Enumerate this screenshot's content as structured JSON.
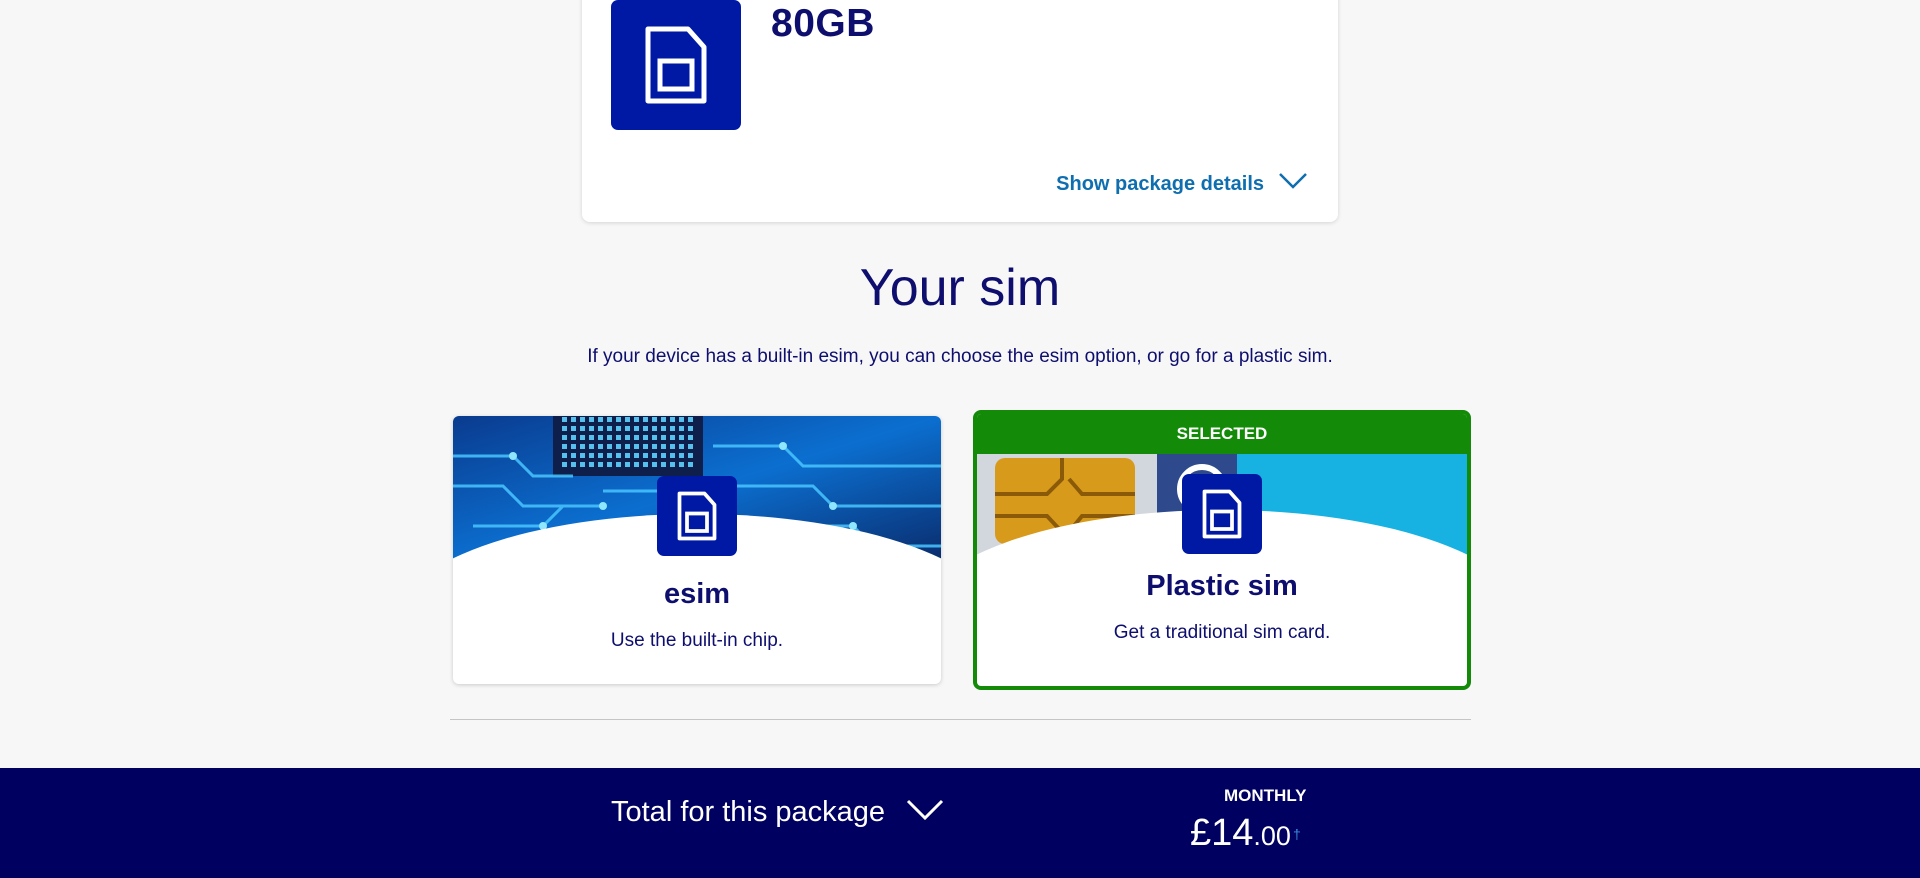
{
  "package": {
    "data_allowance": "80GB",
    "details_link": "Show package details",
    "icons": {
      "sim": "sim-card-icon",
      "expand": "chevron-down-icon"
    }
  },
  "sim_section": {
    "title": "Your sim",
    "description": "If your device has a built-in esim, you can choose the esim option, or go for a plastic sim.",
    "options": [
      {
        "title": "esim",
        "subtitle": "Use the built-in chip.",
        "selected": false,
        "icon": "sim-card-icon",
        "banner": "circuit-board"
      },
      {
        "title": "Plastic sim",
        "subtitle": "Get a traditional sim card.",
        "selected": true,
        "badge": "SELECTED",
        "icon": "sim-card-icon",
        "banner": "chip-card"
      }
    ]
  },
  "footer": {
    "total_label": "Total for this package",
    "period": "MONTHLY",
    "price_main": "£14",
    "price_decimal": ".00",
    "price_dagger": "†"
  },
  "colors": {
    "brand_navy": "#000060",
    "brand_blue": "#0019a5",
    "selected_green": "#138a08",
    "link_blue": "#0e6eb0",
    "text": "#0e0e6e"
  }
}
